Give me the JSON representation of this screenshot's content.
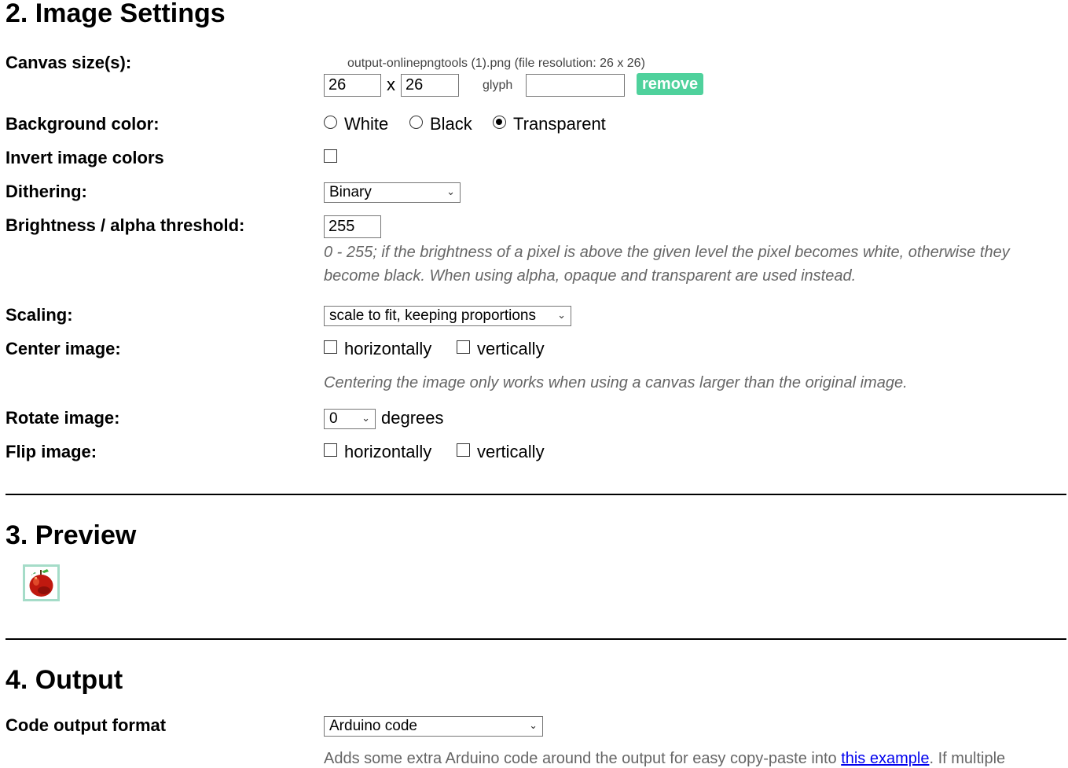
{
  "settings": {
    "heading": "2. Image Settings",
    "canvas": {
      "label": "Canvas size(s):",
      "file_info": "output-onlinepngtools (1).png (file resolution: 26 x 26)",
      "width": "26",
      "separator": "x",
      "height": "26",
      "glyph_label": "glyph",
      "glyph_value": "",
      "remove_label": "remove"
    },
    "background": {
      "label": "Background color:",
      "options": [
        "White",
        "Black",
        "Transparent"
      ],
      "selected": "Transparent"
    },
    "invert": {
      "label": "Invert image colors",
      "checked": false
    },
    "dithering": {
      "label": "Dithering:",
      "value": "Binary"
    },
    "threshold": {
      "label": "Brightness / alpha threshold:",
      "value": "255",
      "hint_line1": "0 - 255; if the brightness of a pixel is above the given level the pixel becomes white, otherwise they",
      "hint_line2": "become black. When using alpha, opaque and transparent are used instead."
    },
    "scaling": {
      "label": "Scaling:",
      "value": "scale to fit, keeping proportions"
    },
    "center": {
      "label": "Center image:",
      "horizontal_label": "horizontally",
      "vertical_label": "vertically",
      "hint": "Centering the image only works when using a canvas larger than the original image."
    },
    "rotate": {
      "label": "Rotate image:",
      "value": "0",
      "unit": "degrees"
    },
    "flip": {
      "label": "Flip image:",
      "horizontal_label": "horizontally",
      "vertical_label": "vertically"
    }
  },
  "preview": {
    "heading": "3. Preview"
  },
  "output": {
    "heading": "4. Output",
    "format_label": "Code output format",
    "format_value": "Arduino code",
    "hint_prefix": "Adds some extra Arduino code around the output for easy copy-paste into ",
    "hint_link": "this example",
    "hint_suffix": ". If multiple"
  },
  "colors": {
    "accent": "#4fd19c",
    "preview_border": "#a5dcc8",
    "link": "#0000ee"
  }
}
